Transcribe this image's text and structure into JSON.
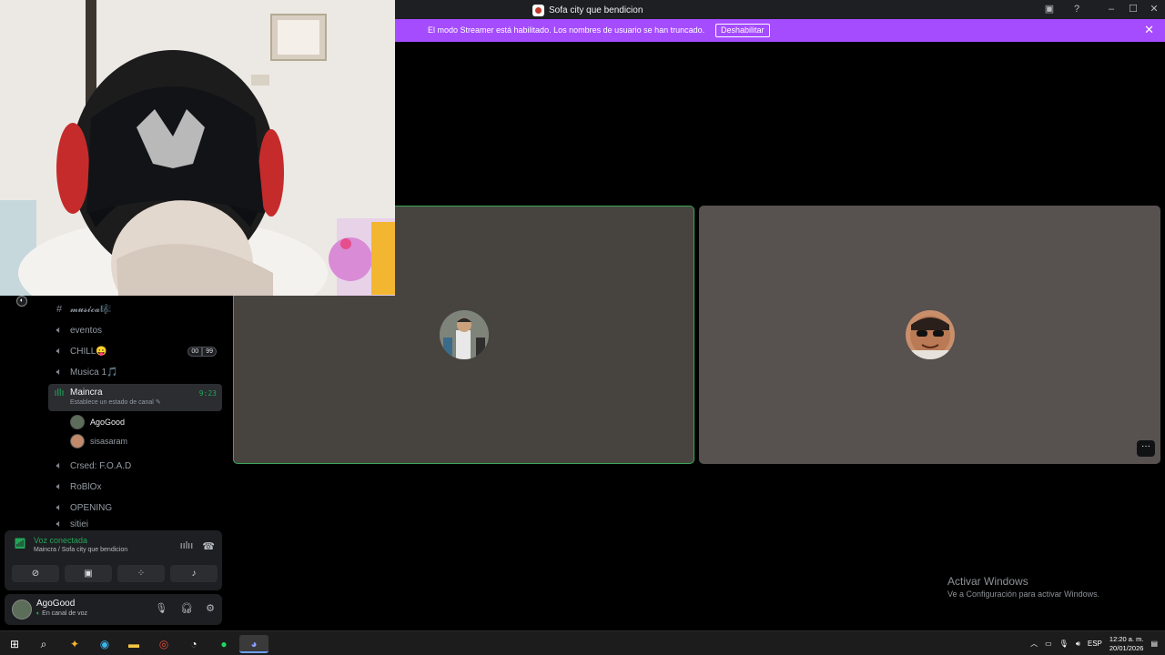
{
  "window": {
    "title": "Sofa city que bendicion",
    "controls": [
      "inbox-icon",
      "help-icon",
      "minimize-icon",
      "maximize-icon",
      "close-icon"
    ]
  },
  "banner": {
    "message": "El modo Streamer está habilitado. Los nombres de usuario se han truncado.",
    "button_label": "Deshabilitar",
    "color": "#a54cff"
  },
  "sidebar": {
    "channels": [
      {
        "name": "𝓶𝓾𝓼𝓲𝓬𝓪🎼",
        "type": "text"
      },
      {
        "name": "eventos",
        "type": "voice"
      },
      {
        "name": "CHILL😛",
        "type": "voice",
        "badges": [
          "00",
          "99"
        ]
      },
      {
        "name": "Musica 1🎵",
        "type": "voice"
      },
      {
        "name": "Maincra",
        "type": "voice",
        "active": true,
        "status_placeholder": "Establece un estado de canal",
        "timer": "9:23"
      },
      {
        "name": "Crsed: F.O.A.D",
        "type": "voice"
      },
      {
        "name": "RoBlOx",
        "type": "voice"
      },
      {
        "name": "OPENING",
        "type": "voice"
      },
      {
        "name": "sitiei",
        "type": "voice"
      }
    ],
    "members": [
      {
        "name": "AgoGood",
        "is_self": true
      },
      {
        "name": "sisasaram",
        "is_self": false
      }
    ]
  },
  "voice_panel": {
    "title": "Voz conectada",
    "subtitle": "Maincra / Sofa city que bendicion",
    "actions": [
      "camera-off-icon",
      "screen-share-icon",
      "activities-icon",
      "soundboard-icon"
    ]
  },
  "user_panel": {
    "name": "AgoGood",
    "status": "En canal de voz"
  },
  "tiles": [
    {
      "speaking": true,
      "color": "#47443f"
    },
    {
      "speaking": false,
      "color": "#575150"
    }
  ],
  "watermark": {
    "line1": "Activar Windows",
    "line2": "Ve a Configuración para activar Windows."
  },
  "taskbar": {
    "language": "ESP",
    "time": "12:20 a. m.",
    "date": "20/01/2026"
  }
}
